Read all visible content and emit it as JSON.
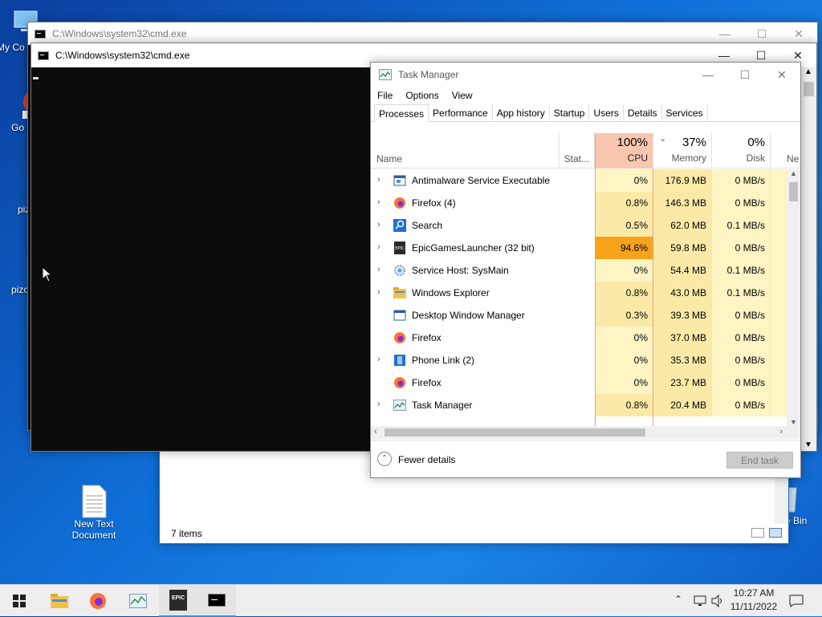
{
  "desktop": {
    "icons": [
      {
        "label": "My Co"
      },
      {
        "label": "Go Chr"
      },
      {
        "label": "piz"
      },
      {
        "label": "pizo"
      },
      {
        "label": "New Text Document"
      },
      {
        "label": "e Bin"
      }
    ]
  },
  "explorer": {
    "status_items": "7 items"
  },
  "cmd_back": {
    "title": "C:\\Windows\\system32\\cmd.exe"
  },
  "cmd_front": {
    "title": "C:\\Windows\\system32\\cmd.exe"
  },
  "task_manager": {
    "title": "Task Manager",
    "menu": [
      "File",
      "Options",
      "View"
    ],
    "tabs": [
      "Processes",
      "Performance",
      "App history",
      "Startup",
      "Users",
      "Details",
      "Services"
    ],
    "columns": {
      "name": "Name",
      "status": "Stat...",
      "cpu_pct": "100%",
      "cpu": "CPU",
      "mem_pct": "37%",
      "mem": "Memory",
      "disk_pct": "0%",
      "disk": "Disk",
      "net": "Ne"
    },
    "rows": [
      {
        "name": "Antimalware Service Executable",
        "cpu": "0%",
        "mem": "176.9 MB",
        "disk": "0 MB/s",
        "expand": true,
        "icon": "shield-app-icon"
      },
      {
        "name": "Firefox (4)",
        "cpu": "0.8%",
        "mem": "146.3 MB",
        "disk": "0 MB/s",
        "expand": true,
        "icon": "firefox-icon"
      },
      {
        "name": "Search",
        "cpu": "0.5%",
        "mem": "62.0 MB",
        "disk": "0.1 MB/s",
        "expand": true,
        "icon": "search-icon"
      },
      {
        "name": "EpicGamesLauncher (32 bit)",
        "cpu": "94.6%",
        "mem": "59.8 MB",
        "disk": "0 MB/s",
        "expand": true,
        "icon": "epic-icon"
      },
      {
        "name": "Service Host: SysMain",
        "cpu": "0%",
        "mem": "54.4 MB",
        "disk": "0.1 MB/s",
        "expand": true,
        "icon": "gear-icon"
      },
      {
        "name": "Windows Explorer",
        "cpu": "0.8%",
        "mem": "43.0 MB",
        "disk": "0.1 MB/s",
        "expand": true,
        "icon": "folder-icon"
      },
      {
        "name": "Desktop Window Manager",
        "cpu": "0.3%",
        "mem": "39.3 MB",
        "disk": "0 MB/s",
        "expand": false,
        "icon": "window-app-icon"
      },
      {
        "name": "Firefox",
        "cpu": "0%",
        "mem": "37.0 MB",
        "disk": "0 MB/s",
        "expand": false,
        "icon": "firefox-icon"
      },
      {
        "name": "Phone Link (2)",
        "cpu": "0%",
        "mem": "35.3 MB",
        "disk": "0 MB/s",
        "expand": true,
        "icon": "phone-link-icon"
      },
      {
        "name": "Firefox",
        "cpu": "0%",
        "mem": "23.7 MB",
        "disk": "0 MB/s",
        "expand": false,
        "icon": "firefox-icon"
      },
      {
        "name": "Task Manager",
        "cpu": "0.8%",
        "mem": "20.4 MB",
        "disk": "0 MB/s",
        "expand": true,
        "icon": "task-manager-icon"
      }
    ],
    "fewer_details": "Fewer details",
    "end_task": "End task"
  },
  "taskbar": {
    "time": "10:27 AM",
    "date": "11/11/2022",
    "apps": [
      "explorer-icon",
      "firefox-icon",
      "task-manager-icon",
      "epic-icon",
      "cmd-icon"
    ],
    "epic_text": "EPIC"
  },
  "colors": {
    "cpu_high": "#f7a21b",
    "cpu_header": "#f9c6b0",
    "heat_light": "#fff4c4",
    "heat_mid": "#fbeaa7",
    "accent": "#3a8be0"
  }
}
